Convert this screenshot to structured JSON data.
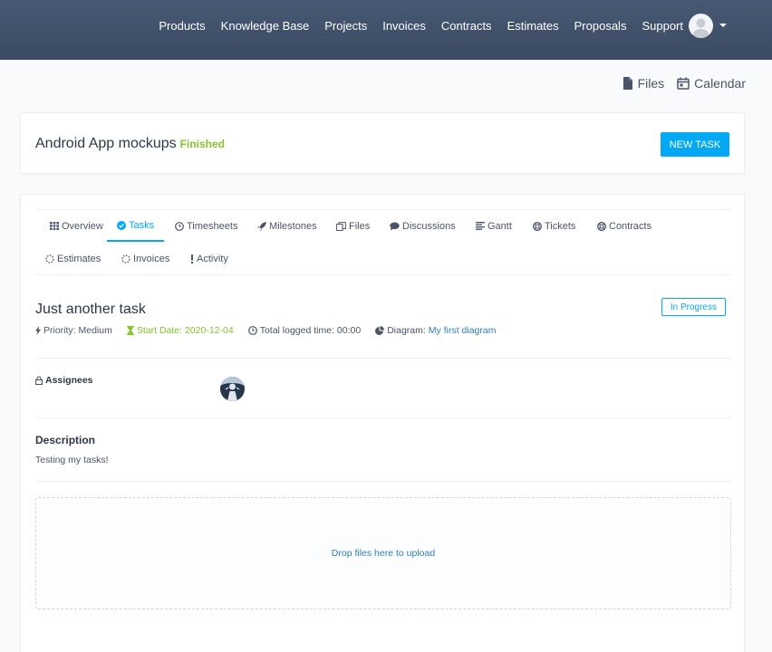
{
  "nav": {
    "links": [
      "Products",
      "Knowledge Base",
      "Projects",
      "Invoices",
      "Contracts",
      "Estimates",
      "Proposals",
      "Support"
    ],
    "avatar_icon": "user-avatar-icon",
    "dropdown_icon": "caret-down-icon"
  },
  "quick_links": {
    "files": "Files",
    "calendar": "Calendar"
  },
  "project": {
    "title": "Android App mockups",
    "status": "Finished",
    "status_color": "#84c529",
    "new_task_label": "NEW TASK",
    "accent_color": "#03a9f4"
  },
  "tabs": [
    {
      "label": "Overview",
      "icon": "grid-icon"
    },
    {
      "label": "Tasks",
      "icon": "check-circle-icon",
      "active": true
    },
    {
      "label": "Timesheets",
      "icon": "clock-icon"
    },
    {
      "label": "Milestones",
      "icon": "rocket-icon"
    },
    {
      "label": "Files",
      "icon": "files-icon"
    },
    {
      "label": "Discussions",
      "icon": "comment-icon"
    },
    {
      "label": "Gantt",
      "icon": "align-left-icon"
    },
    {
      "label": "Tickets",
      "icon": "life-ring-icon"
    },
    {
      "label": "Contracts",
      "icon": "life-ring-icon"
    },
    {
      "label": "Estimates",
      "icon": "spinner-icon"
    },
    {
      "label": "Invoices",
      "icon": "spinner-icon"
    },
    {
      "label": "Activity",
      "icon": "exclamation-icon"
    }
  ],
  "task": {
    "title": "Just another task",
    "status": "In Progress",
    "priority": "Priority: Medium",
    "start_date": "Start Date: 2020-12-04",
    "logged_time": "Total logged time: 00:00",
    "diagram_label": "Diagram:",
    "diagram_link": "My first diagram"
  },
  "assignees": {
    "label": "Assignees"
  },
  "description": {
    "heading": "Description",
    "text": "Testing my tasks!"
  },
  "dropzone": {
    "text": "Drop files here to upload"
  }
}
